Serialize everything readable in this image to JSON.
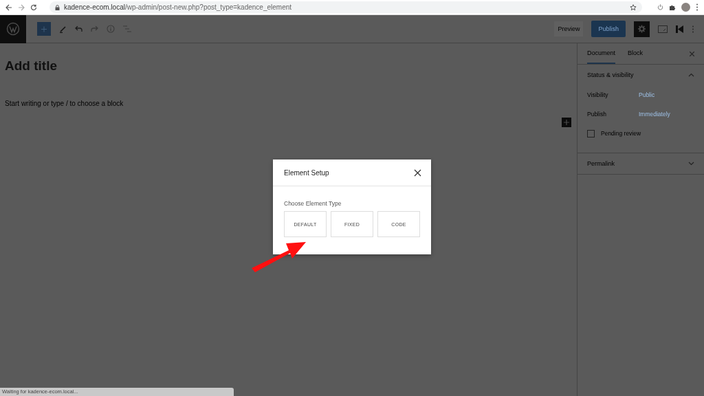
{
  "browser": {
    "url_host": "kadence-ecom.local",
    "url_path": "/wp-admin/post-new.php?post_type=kadence_element"
  },
  "toolbar": {
    "preview": "Preview",
    "publish": "Publish",
    "settings_active": true
  },
  "editor": {
    "title_placeholder": "Add title",
    "body_placeholder": "Start writing or type / to choose a block"
  },
  "sidebar": {
    "tabs": [
      {
        "label": "Document",
        "selected": true
      },
      {
        "label": "Block",
        "selected": false
      }
    ],
    "panels": [
      {
        "title": "Status & visibility",
        "expanded": true,
        "rows": [
          {
            "kind": "setting",
            "label": "Visibility",
            "value": "Public"
          },
          {
            "kind": "setting",
            "label": "Publish",
            "value": "Immediately"
          },
          {
            "kind": "checkbox",
            "label": "Pending review",
            "checked": false
          }
        ]
      },
      {
        "title": "Permalink",
        "expanded": false
      }
    ]
  },
  "modal": {
    "title": "Element Setup",
    "label": "Choose Element Type",
    "options": [
      "DEFAULT",
      "FIXED",
      "CODE"
    ]
  },
  "status_bar": "Waiting for kadence-ecom.local..."
}
